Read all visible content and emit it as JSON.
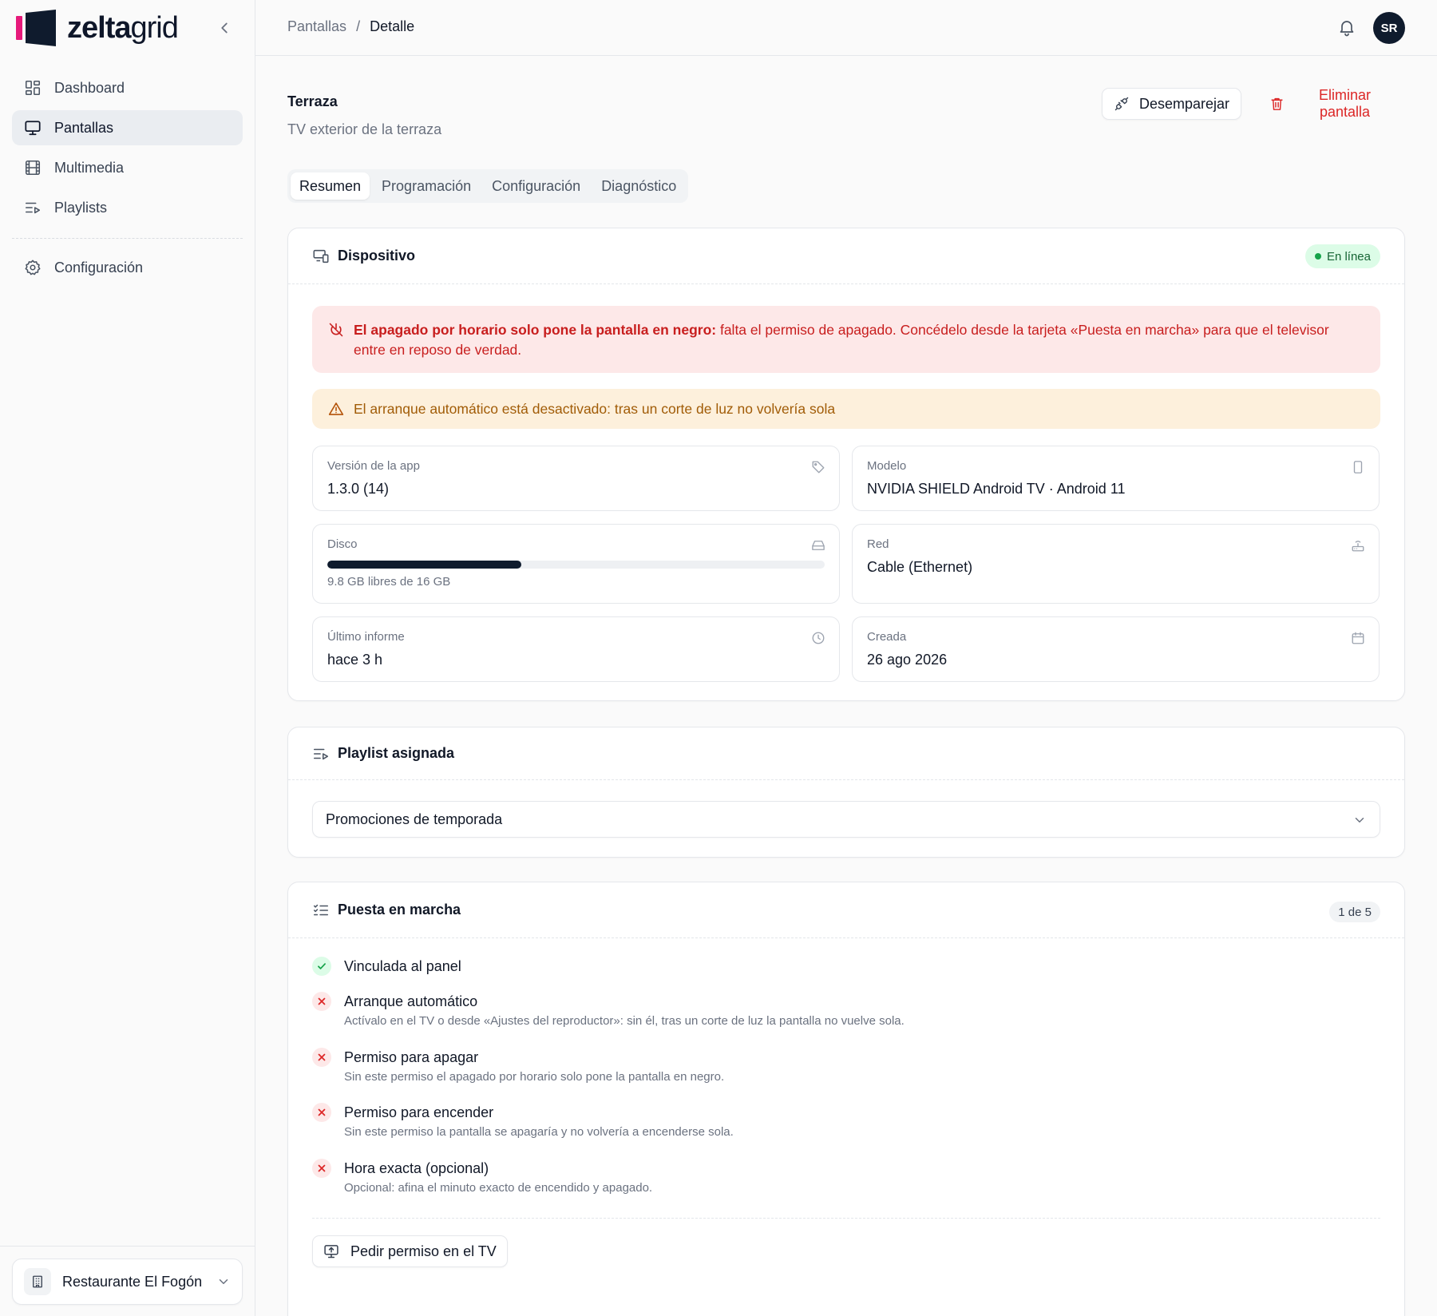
{
  "brand": {
    "name_bold": "zelta",
    "name_light": "grid",
    "colors": {
      "accent": "#e6197a",
      "dark": "#0f1b2d"
    }
  },
  "sidebar": {
    "items": [
      {
        "label": "Dashboard",
        "icon": "dashboard-icon"
      },
      {
        "label": "Pantallas",
        "icon": "monitor-icon",
        "active": true
      },
      {
        "label": "Multimedia",
        "icon": "film-icon"
      },
      {
        "label": "Playlists",
        "icon": "playlist-icon"
      }
    ],
    "settings": {
      "label": "Configuración",
      "icon": "gear-icon"
    },
    "org": {
      "name": "Restaurante El Fogón",
      "icon": "building-icon"
    }
  },
  "topbar": {
    "breadcrumb": {
      "parent": "Pantallas",
      "separator": "/",
      "current": "Detalle"
    },
    "user_initials": "SR"
  },
  "header": {
    "title": "Terraza",
    "subtitle": "TV exterior de la terraza",
    "unpair_label": "Desemparejar",
    "delete_label": "Eliminar pantalla"
  },
  "tabs": [
    {
      "label": "Resumen",
      "active": true
    },
    {
      "label": "Programación"
    },
    {
      "label": "Configuración"
    },
    {
      "label": "Diagnóstico"
    }
  ],
  "device": {
    "title": "Dispositivo",
    "status": "En línea",
    "alert_red": {
      "bold": "El apagado por horario solo pone la pantalla en negro:",
      "text": " falta el permiso de apagado. Concédelo desde la tarjeta «Puesta en marcha» para que el televisor entre en reposo de verdad."
    },
    "alert_amber": "El arranque automático está desactivado: tras un corte de luz no volvería sola",
    "stats": {
      "app_version": {
        "label": "Versión de la app",
        "value": "1.3.0 (14)"
      },
      "model": {
        "label": "Modelo",
        "value": "NVIDIA SHIELD Android TV · Android 11"
      },
      "disk": {
        "label": "Disco",
        "text": "9.8 GB libres de 16 GB",
        "used_fraction": 0.39
      },
      "network": {
        "label": "Red",
        "value": "Cable (Ethernet)"
      },
      "last_report": {
        "label": "Último informe",
        "value": "hace 3 h"
      },
      "created": {
        "label": "Creada",
        "value": "26 ago 2026"
      }
    }
  },
  "playlist": {
    "title": "Playlist asignada",
    "selected": "Promociones de temporada"
  },
  "setup": {
    "title": "Puesta en marcha",
    "progress": "1 de 5",
    "items": [
      {
        "status": "ok",
        "title": "Vinculada al panel",
        "desc": ""
      },
      {
        "status": "no",
        "title": "Arranque automático",
        "desc": "Actívalo en el TV o desde «Ajustes del reproductor»: sin él, tras un corte de luz la pantalla no vuelve sola."
      },
      {
        "status": "no",
        "title": "Permiso para apagar",
        "desc": "Sin este permiso el apagado por horario solo pone la pantalla en negro."
      },
      {
        "status": "no",
        "title": "Permiso para encender",
        "desc": "Sin este permiso la pantalla se apagaría y no volvería a encenderse sola."
      },
      {
        "status": "no",
        "title": "Hora exacta (opcional)",
        "desc": "Opcional: afina el minuto exacto de encendido y apagado."
      }
    ],
    "ask_label": "Pedir permiso en el TV"
  }
}
